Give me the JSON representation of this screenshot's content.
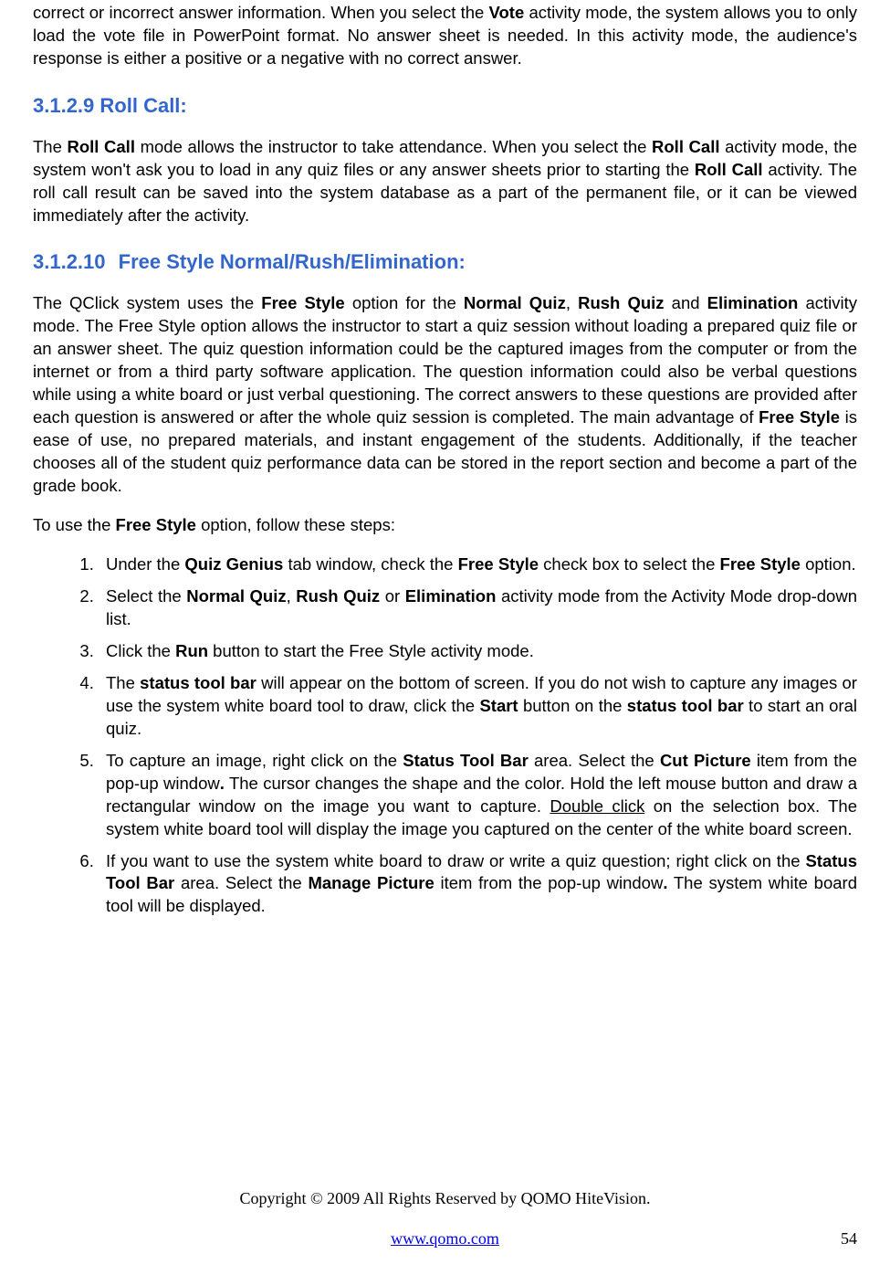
{
  "intro_frag1": "correct or incorrect answer information. When you select the ",
  "intro_vote": "Vote",
  "intro_frag2": " activity mode, the system allows you to only load the vote file in PowerPoint format. No answer sheet is needed. In this activity mode, the audience's response is either a positive or a negative with no correct answer.",
  "h1_number": "3.1.2.9",
  "h1_title": "Roll Call:",
  "p1_frag1": "The ",
  "p1_b1": "Roll Call",
  "p1_frag2": " mode allows the instructor to take attendance. When you select the ",
  "p1_b2": "Roll Call",
  "p1_frag3": " activity mode, the system won't ask you to load in any quiz files or any answer sheets prior to starting the ",
  "p1_b3": "Roll Call",
  "p1_frag4": " activity. The roll call result can be saved into the system database as a part of the permanent file, or it can be viewed immediately after the activity.",
  "h2_number": "3.1.2.10",
  "h2_title": "Free Style Normal/Rush/Elimination:",
  "p2_frag1": "The QClick system uses the ",
  "p2_b1": "Free Style",
  "p2_frag2": " option for the ",
  "p2_b2": "Normal Quiz",
  "p2_frag3": ", ",
  "p2_b3": "Rush Quiz",
  "p2_frag4": " and ",
  "p2_b4": "Elimination",
  "p2_frag5": " activity mode. The Free Style option allows the instructor to start a quiz session without loading a prepared quiz file or an answer sheet. The quiz question information could be the captured images from the computer or from the internet or from a third party software application. The question information could also be verbal questions while using a white board or just verbal questioning. The correct answers to these questions are provided after each question is answered or after the whole quiz session is completed. The main advantage of ",
  "p2_b5": "Free Style",
  "p2_frag6": " is ease of use, no prepared materials, and instant engagement of the students. Additionally, if the teacher chooses all of the student quiz performance data can be stored in the report section and become a part of the grade book.",
  "p3_frag1": "To use the ",
  "p3_b1": "Free Style",
  "p3_frag2": " option, follow these steps:",
  "li1_frag1": "Under the ",
  "li1_b1": "Quiz Genius",
  "li1_frag2": " tab window, check the ",
  "li1_b2": "Free Style",
  "li1_frag3": " check box to select the ",
  "li1_b3": "Free Style",
  "li1_frag4": " option.",
  "li2_frag1": "Select the ",
  "li2_b1": "Normal Quiz",
  "li2_frag2": ", ",
  "li2_b2": "Rush Quiz",
  "li2_frag3": " or ",
  "li2_b3": "Elimination",
  "li2_frag4": " activity mode from the Activity Mode drop-down list.",
  "li3_frag1": "Click the ",
  "li3_b1": "Run",
  "li3_frag2": " button to start the Free Style activity mode.",
  "li4_frag1": "The ",
  "li4_b1": "status tool bar",
  "li4_frag2": " will appear on the bottom of screen. If you do not wish to capture any images or use the system white board tool to draw, click the ",
  "li4_b2": "Start",
  "li4_frag3": " button on the ",
  "li4_b3": "status tool bar",
  "li4_frag4": " to start an oral quiz.",
  "li5_frag1": "To capture an image, right click on the ",
  "li5_b1": "Status Tool Bar",
  "li5_frag2": " area. Select the ",
  "li5_b2": "Cut Picture",
  "li5_frag3": " item from the pop-up window",
  "li5_b3": ".",
  "li5_frag4": " The cursor changes the shape and the color. Hold the left mouse button and draw a rectangular window on the image you want to capture. ",
  "li5_u1": "Double click",
  "li5_frag5": " on the selection box. The system white board tool will display the image you captured on the center of the white board screen.",
  "li6_frag1": "If you want to use the system white board to draw or write a quiz question;  right click on the ",
  "li6_b1": "Status Tool Bar",
  "li6_frag2": " area. Select the ",
  "li6_b2": "Manage Picture",
  "li6_frag3": " item from the pop-up window",
  "li6_b3": ".",
  "li6_frag4": " The system white board tool will be displayed.",
  "footer_copy": "Copyright © 2009 All Rights Reserved by QOMO HiteVision.",
  "footer_url": "www.qomo.com",
  "footer_page": "54"
}
